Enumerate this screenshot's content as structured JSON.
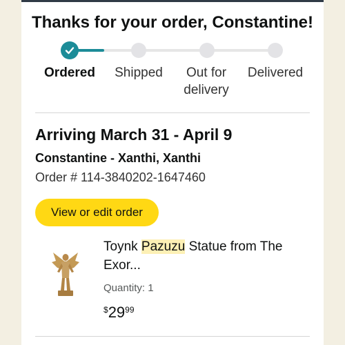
{
  "header": {
    "title": "Thanks for your order, Constantine!"
  },
  "tracker": {
    "steps": [
      {
        "label": "Ordered",
        "status": "complete"
      },
      {
        "label": "Shipped",
        "status": "pending"
      },
      {
        "label": "Out for delivery",
        "status": "pending"
      },
      {
        "label": "Delivered",
        "status": "pending"
      }
    ],
    "step3_line1": "Out for",
    "step3_line2": "delivery",
    "accent_color": "#1c8c98"
  },
  "delivery": {
    "arriving": "Arriving March 31 - April 9",
    "address": "Constantine - Xanthi, Xanthi",
    "order_number": "Order # 114-3840202-1647460"
  },
  "actions": {
    "view_edit_label": "View or edit order",
    "button_color": "#ffd814"
  },
  "item": {
    "name_before": "Toynk ",
    "name_highlight": "Pazuzu",
    "name_after": " Statue from The Exor...",
    "quantity": "Quantity: 1",
    "price_currency": "$",
    "price_whole": "29",
    "price_fraction": "99",
    "thumbnail_icon": "statue-icon"
  }
}
